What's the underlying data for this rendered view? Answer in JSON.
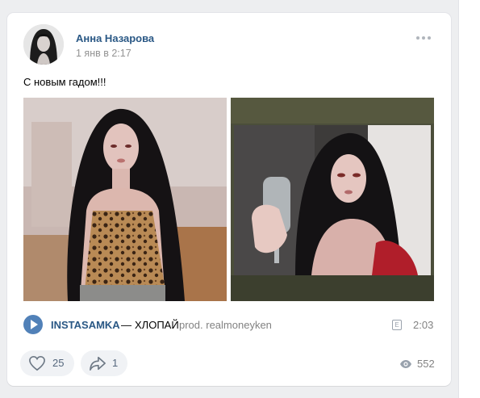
{
  "post": {
    "author": "Анна Назарова",
    "date": "1 янв в 2:17",
    "text": "С новым гадом!!!"
  },
  "audio": {
    "artist": "INSTASAMKA",
    "separator": "—",
    "title": "ХЛОПАЙ",
    "featuring": "prod. realmoneyken",
    "explicit_badge": "E",
    "duration": "2:03"
  },
  "actions": {
    "likes": "25",
    "shares": "1",
    "views": "552"
  },
  "icons": {
    "more": "more-horizontal-icon",
    "play": "play-icon",
    "like": "heart-icon",
    "share": "share-arrow-icon",
    "views": "eye-icon"
  },
  "colors": {
    "link": "#2a5885",
    "accent": "#5181b8",
    "muted": "#828282",
    "background": "#edeef0"
  }
}
